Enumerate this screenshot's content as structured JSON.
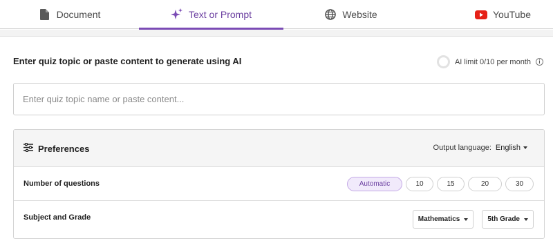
{
  "tabs": [
    {
      "label": "Document",
      "icon": "document-icon"
    },
    {
      "label": "Text or Prompt",
      "icon": "sparkle-icon"
    },
    {
      "label": "Website",
      "icon": "globe-icon"
    },
    {
      "label": "YouTube",
      "icon": "youtube-icon"
    }
  ],
  "active_tab": "Text or Prompt",
  "colors": {
    "accent": "#7b4bb5",
    "youtube": "#e62117"
  },
  "main": {
    "heading": "Enter quiz topic or paste content to generate using AI",
    "ai_limit": "AI limit 0/10 per month",
    "ai_limit_used": 0,
    "ai_limit_total": 10,
    "prompt_placeholder": "Enter quiz topic name or paste content...",
    "prompt_value": ""
  },
  "preferences": {
    "title": "Preferences",
    "output_language_label": "Output language:",
    "output_language": "English",
    "num_questions_label": "Number of questions",
    "num_question_options": [
      "Automatic",
      "10",
      "15",
      "20",
      "30"
    ],
    "num_questions_selected": "Automatic",
    "subject_grade_label": "Subject and Grade",
    "subject": "Mathematics",
    "grade": "5th Grade"
  }
}
